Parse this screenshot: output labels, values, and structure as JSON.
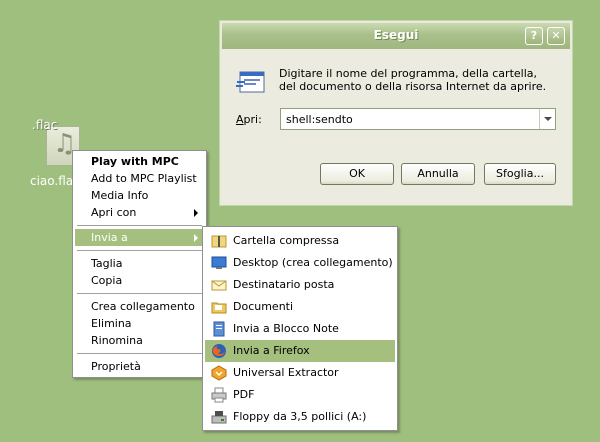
{
  "desktop": {
    "file_ext": ".flac",
    "file_name": "ciao.flac"
  },
  "context_menu": {
    "items": [
      {
        "label": "Play with MPC"
      },
      {
        "label": "Add to MPC Playlist"
      },
      {
        "label": "Media Info"
      },
      {
        "label": "Apri con"
      },
      {
        "label": "Invia a"
      },
      {
        "label": "Taglia"
      },
      {
        "label": "Copia"
      },
      {
        "label": "Crea collegamento"
      },
      {
        "label": "Elimina"
      },
      {
        "label": "Rinomina"
      },
      {
        "label": "Proprietà"
      }
    ]
  },
  "send_to_menu": {
    "items": [
      {
        "label": "Cartella compressa",
        "icon": "zip-folder-icon"
      },
      {
        "label": "Desktop (crea collegamento)",
        "icon": "desktop-icon"
      },
      {
        "label": "Destinatario posta",
        "icon": "mail-icon"
      },
      {
        "label": "Documenti",
        "icon": "documents-folder-icon"
      },
      {
        "label": "Invia a Blocco Note",
        "icon": "notepad-icon"
      },
      {
        "label": "Invia a Firefox",
        "icon": "firefox-icon"
      },
      {
        "label": "Universal Extractor",
        "icon": "extractor-icon"
      },
      {
        "label": "PDF",
        "icon": "pdf-printer-icon"
      },
      {
        "label": "Floppy da 3,5 pollici (A:)",
        "icon": "floppy-icon"
      }
    ]
  },
  "run_dialog": {
    "title": "Esegui",
    "help_label": "?",
    "close_label": "✕",
    "description": "Digitare il nome del programma, della cartella, del documento o della risorsa Internet da aprire.",
    "open_label_accel": "A",
    "open_label_rest": "pri:",
    "open_value": "shell:sendto",
    "ok_label": "OK",
    "cancel_label": "Annulla",
    "browse_label": "Sfoglia..."
  }
}
